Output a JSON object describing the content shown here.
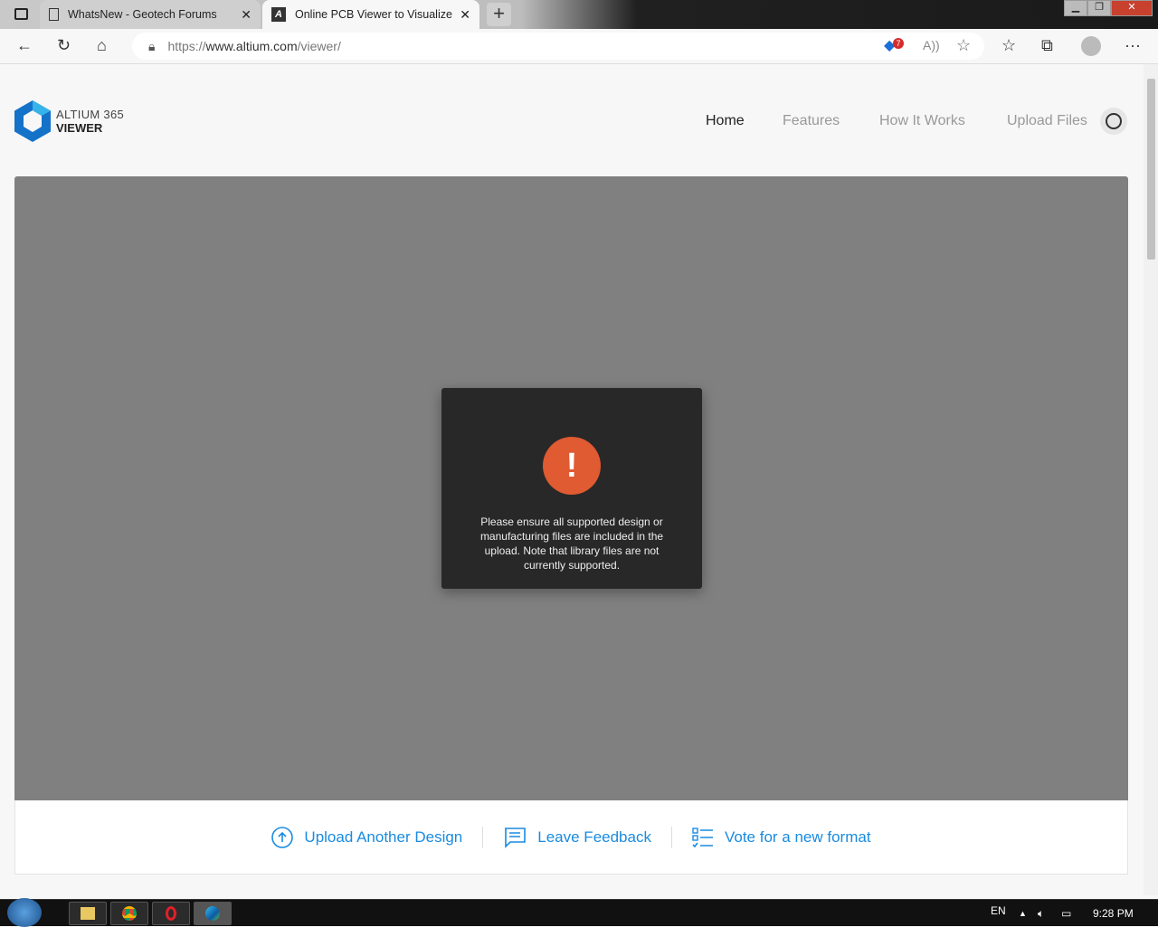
{
  "browser": {
    "tabs": [
      {
        "title": "WhatsNew - Geotech Forums"
      },
      {
        "title": "Online PCB Viewer to Visualize"
      }
    ],
    "url_prefix": "https://",
    "url_domain": "www.altium.com",
    "url_path": "/viewer/",
    "shopping_badge": "7"
  },
  "site": {
    "logo_line1": "ALTIUM 365",
    "logo_line2": "VIEWER",
    "nav": [
      "Home",
      "Features",
      "How It Works",
      "Upload Files"
    ]
  },
  "dialog": {
    "icon": "!",
    "message": "Please ensure all supported design or manufacturing files are included in the upload. Note that library files are not currently supported."
  },
  "actions": {
    "upload": "Upload Another Design",
    "feedback": "Leave Feedback",
    "vote": "Vote for a new format"
  },
  "taskbar": {
    "lang": "EN",
    "time": "9:28 PM"
  },
  "colors": {
    "accent": "#1a8be0",
    "alert": "#e05a32"
  }
}
